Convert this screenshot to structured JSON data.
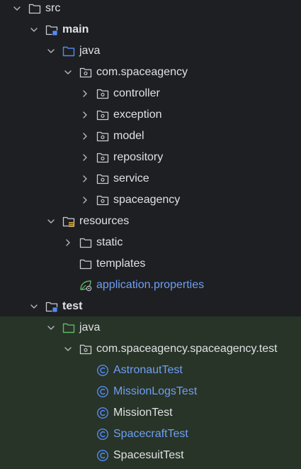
{
  "colors": {
    "background": "#1e1f22",
    "test_background": "#283427",
    "text": "#dfe1e5",
    "modified_text": "#6e9ff5",
    "source_folder": "#548af7",
    "test_folder": "#5fb865",
    "class_icon": "#548af7",
    "spring_leaf": "#5fb865",
    "resources_bars": "#d5a93e"
  },
  "tree": {
    "src": {
      "label": "src",
      "icon": "folder-icon"
    },
    "main": {
      "label": "main",
      "icon": "module-folder-icon"
    },
    "main_java": {
      "label": "java",
      "icon": "source-folder-icon"
    },
    "main_pkg": {
      "label": "com.spaceagency",
      "icon": "package-icon"
    },
    "controller": {
      "label": "controller",
      "icon": "package-icon"
    },
    "exception": {
      "label": "exception",
      "icon": "package-icon"
    },
    "model": {
      "label": "model",
      "icon": "package-icon"
    },
    "repository": {
      "label": "repository",
      "icon": "package-icon"
    },
    "service": {
      "label": "service",
      "icon": "package-icon"
    },
    "spaceagency": {
      "label": "spaceagency",
      "icon": "package-icon"
    },
    "resources": {
      "label": "resources",
      "icon": "resources-folder-icon"
    },
    "static": {
      "label": "static",
      "icon": "folder-icon"
    },
    "templates": {
      "label": "templates",
      "icon": "folder-icon"
    },
    "app_props": {
      "label": "application.properties",
      "icon": "spring-properties-icon"
    },
    "test": {
      "label": "test",
      "icon": "module-folder-icon"
    },
    "test_java": {
      "label": "java",
      "icon": "test-folder-icon"
    },
    "test_pkg": {
      "label": "com.spaceagency.spaceagency.test",
      "icon": "package-icon"
    },
    "astronaut_test": {
      "label": "AstronautTest",
      "icon": "class-icon"
    },
    "missionlogs_test": {
      "label": "MissionLogsTest",
      "icon": "class-icon"
    },
    "mission_test": {
      "label": "MissionTest",
      "icon": "class-icon"
    },
    "spacecraft_test": {
      "label": "SpacecraftTest",
      "icon": "class-icon"
    },
    "spacesuit_test": {
      "label": "SpacesuitTest",
      "icon": "class-icon"
    }
  }
}
